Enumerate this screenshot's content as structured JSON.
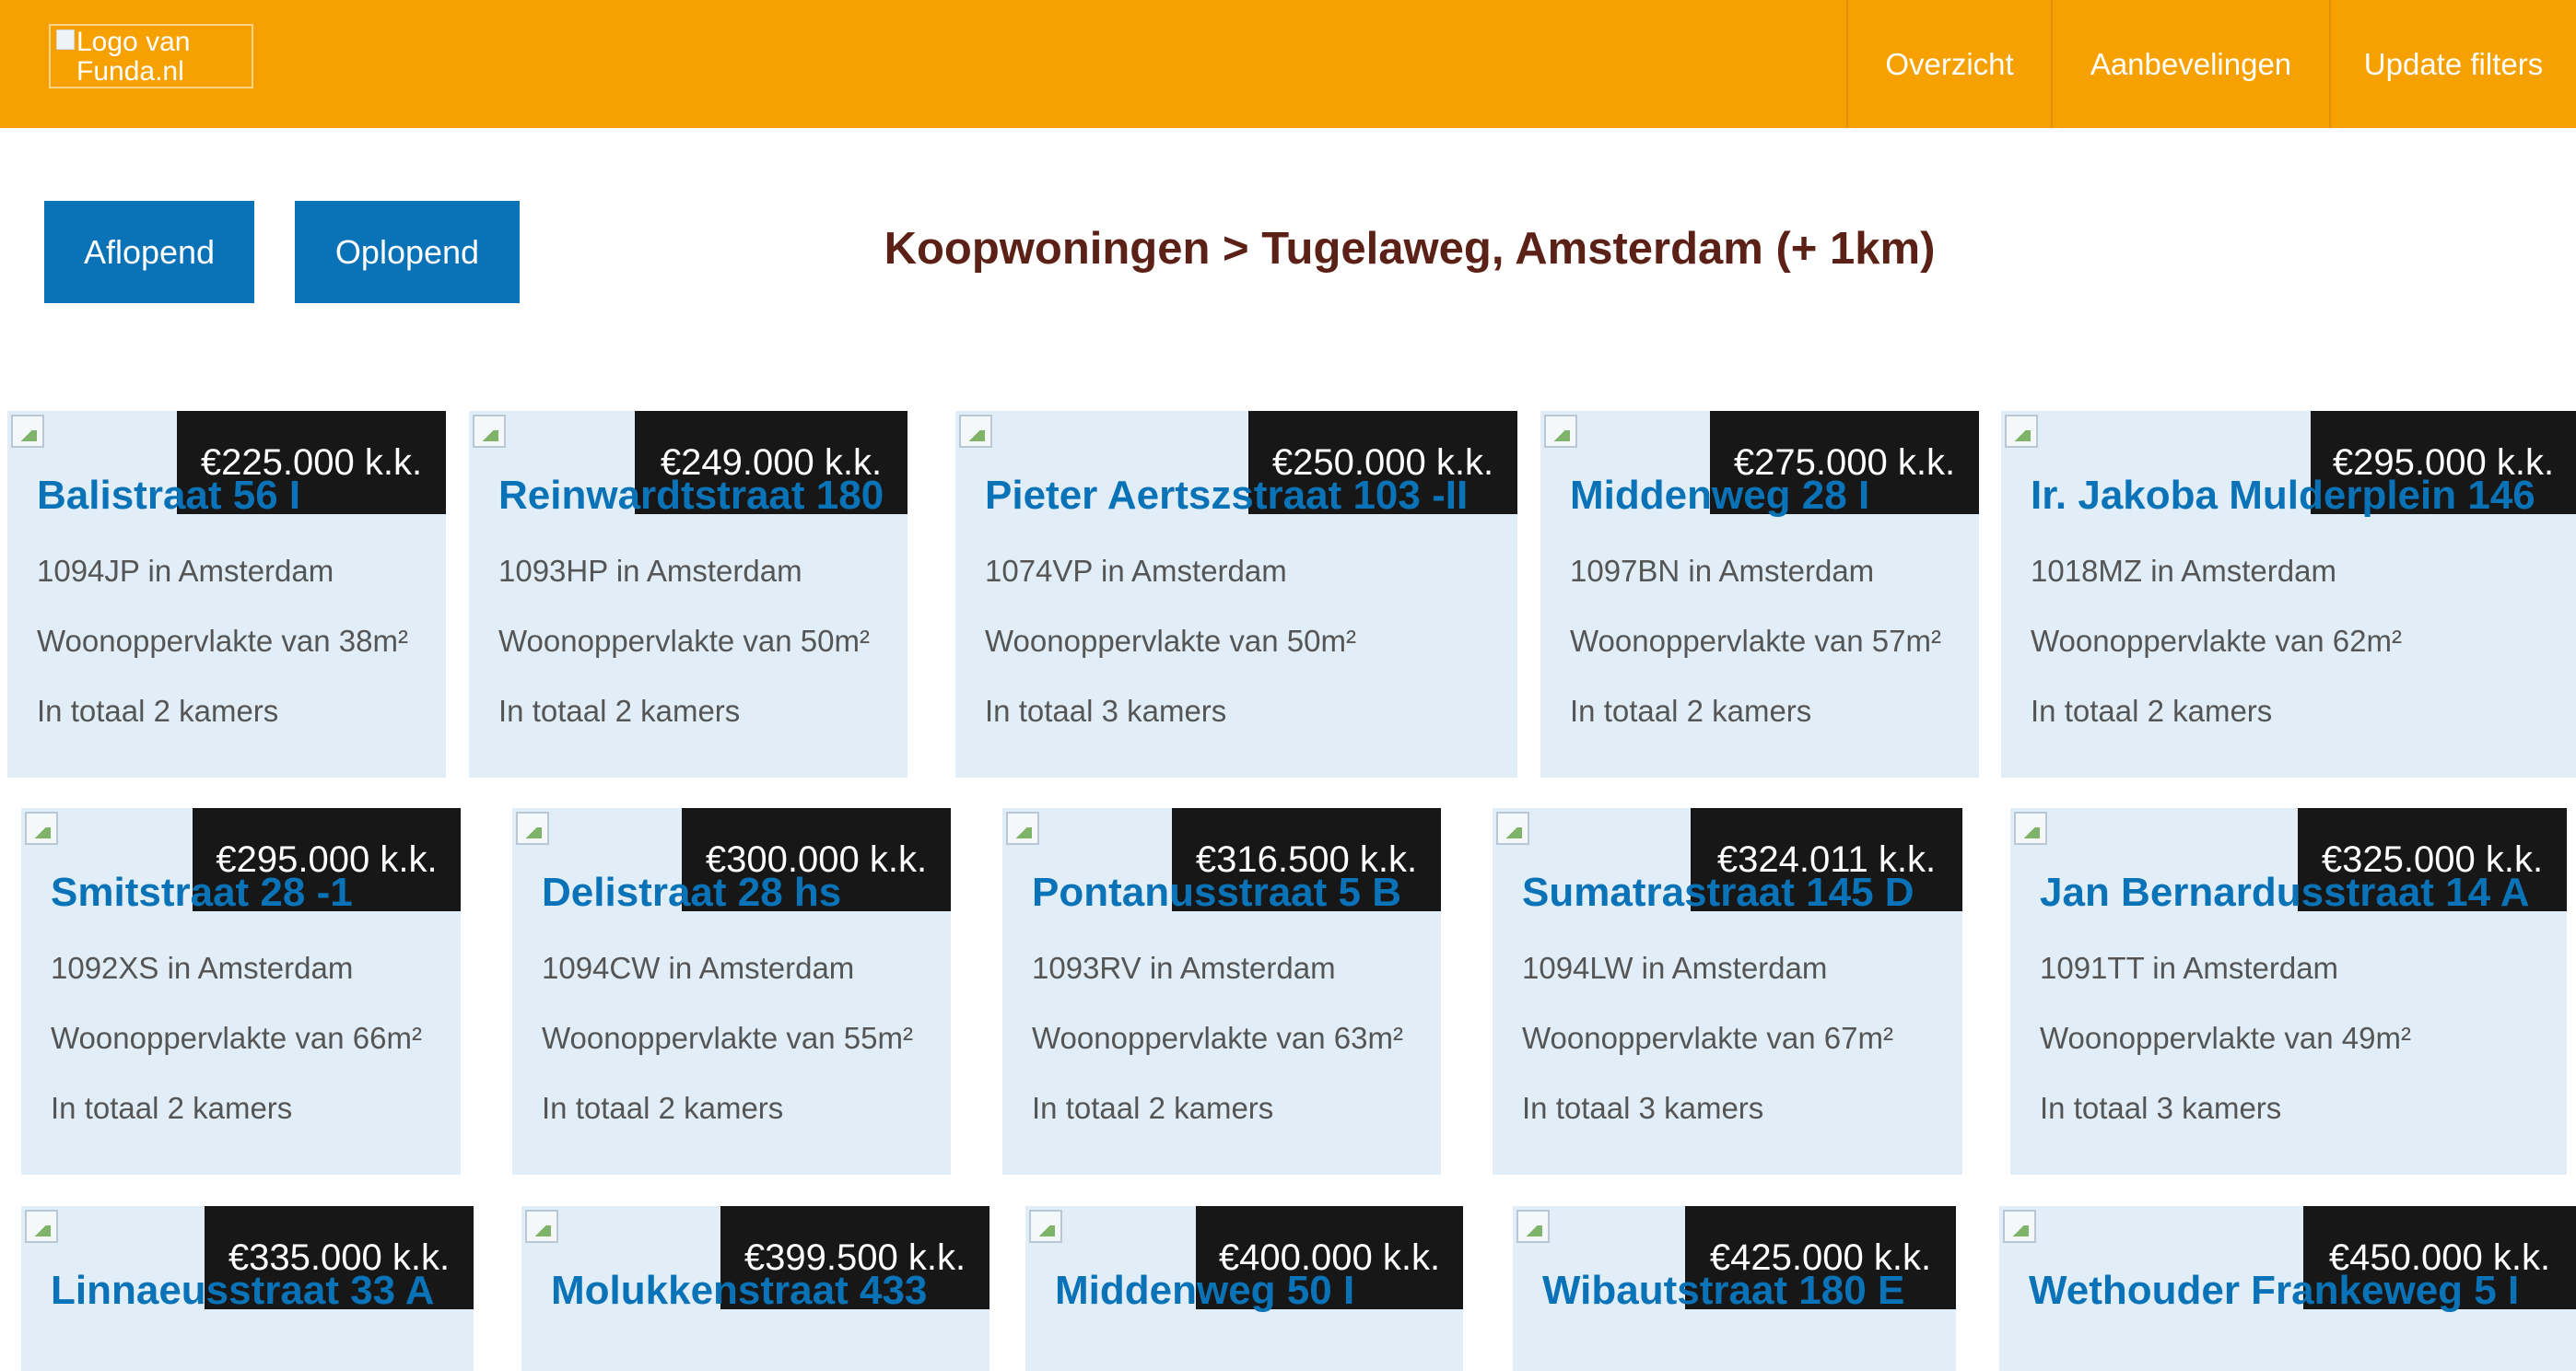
{
  "header": {
    "logo_alt": "Logo van Funda.nl",
    "nav": [
      "Overzicht",
      "Aanbevelingen",
      "Update filters"
    ]
  },
  "sort": {
    "descending": "Aflopend",
    "ascending": "Oplopend"
  },
  "page_title": "Koopwoningen > Tugelaweg, Amsterdam (+ 1km)",
  "listings": [
    {
      "price": "€225.000 k.k.",
      "street": "Balistraat 56 I",
      "postcode": "1094JP in Amsterdam",
      "area": "Woonoppervlakte van 38m²",
      "rooms": "In totaal 2 kamers"
    },
    {
      "price": "€249.000 k.k.",
      "street": "Reinwardtstraat 180",
      "postcode": "1093HP in Amsterdam",
      "area": "Woonoppervlakte van 50m²",
      "rooms": "In totaal 2 kamers"
    },
    {
      "price": "€250.000 k.k.",
      "street": "Pieter Aertszstraat 103 -II",
      "postcode": "1074VP in Amsterdam",
      "area": "Woonoppervlakte van 50m²",
      "rooms": "In totaal 3 kamers"
    },
    {
      "price": "€275.000 k.k.",
      "street": "Middenweg 28 I",
      "postcode": "1097BN in Amsterdam",
      "area": "Woonoppervlakte van 57m²",
      "rooms": "In totaal 2 kamers"
    },
    {
      "price": "€295.000 k.k.",
      "street": "Ir. Jakoba Mulderplein 146",
      "postcode": "1018MZ in Amsterdam",
      "area": "Woonoppervlakte van 62m²",
      "rooms": "In totaal 2 kamers"
    },
    {
      "price": "€295.000 k.k.",
      "street": "Smitstraat 28 -1",
      "postcode": "1092XS in Amsterdam",
      "area": "Woonoppervlakte van 66m²",
      "rooms": "In totaal 2 kamers"
    },
    {
      "price": "€300.000 k.k.",
      "street": "Delistraat 28 hs",
      "postcode": "1094CW in Amsterdam",
      "area": "Woonoppervlakte van 55m²",
      "rooms": "In totaal 2 kamers"
    },
    {
      "price": "€316.500 k.k.",
      "street": "Pontanusstraat 5 B",
      "postcode": "1093RV in Amsterdam",
      "area": "Woonoppervlakte van 63m²",
      "rooms": "In totaal 2 kamers"
    },
    {
      "price": "€324.011 k.k.",
      "street": "Sumatrastraat 145 D",
      "postcode": "1094LW in Amsterdam",
      "area": "Woonoppervlakte van 67m²",
      "rooms": "In totaal 3 kamers"
    },
    {
      "price": "€325.000 k.k.",
      "street": "Jan Bernardusstraat 14 A",
      "postcode": "1091TT in Amsterdam",
      "area": "Woonoppervlakte van 49m²",
      "rooms": "In totaal 3 kamers"
    },
    {
      "price": "€335.000 k.k.",
      "street": "Linnaeusstraat 33 A",
      "postcode": "",
      "area": "",
      "rooms": ""
    },
    {
      "price": "€399.500 k.k.",
      "street": "Molukkenstraat 433",
      "postcode": "",
      "area": "",
      "rooms": ""
    },
    {
      "price": "€400.000 k.k.",
      "street": "Middenweg 50 I",
      "postcode": "",
      "area": "",
      "rooms": ""
    },
    {
      "price": "€425.000 k.k.",
      "street": "Wibautstraat 180 E",
      "postcode": "",
      "area": "",
      "rooms": ""
    },
    {
      "price": "€450.000 k.k.",
      "street": "Wethouder Frankeweg 5 I",
      "postcode": "",
      "area": "",
      "rooms": ""
    }
  ],
  "colors": {
    "header_bg": "#f7a100",
    "button_bg": "#0a73b8",
    "title_text": "#5b2016",
    "card_bg": "#e2eef7",
    "price_badge_bg": "#171717",
    "street_link": "#0a73b8"
  }
}
